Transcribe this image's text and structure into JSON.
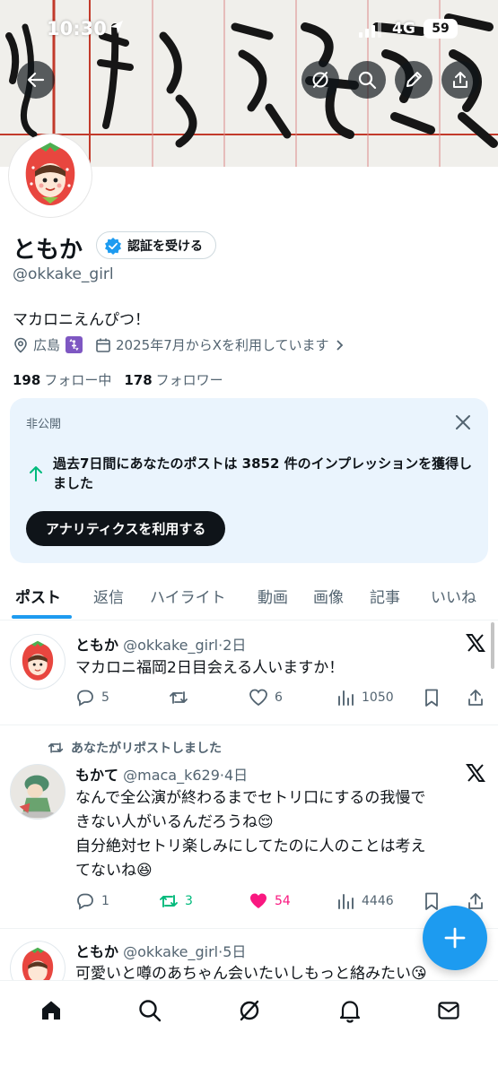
{
  "status_bar": {
    "time": "10:30",
    "network": "4G",
    "battery": "59"
  },
  "header_buttons": [
    "back-icon",
    "grok-icon",
    "search-icon",
    "edit-icon",
    "share-icon"
  ],
  "profile": {
    "name": "ともか",
    "verify_label": "認証を受ける",
    "handle": "@okkake_girl",
    "bio": "マカロニえんぴつ！",
    "location": "広島",
    "joined": "2025年7月からXを利用しています",
    "following_count": "198",
    "following_label": "フォロー中",
    "followers_count": "178",
    "followers_label": "フォロワー"
  },
  "analytics_card": {
    "label": "非公開",
    "message": "過去7日間にあなたのポストは 3852 件のインプレッションを獲得しました",
    "cta": "アナリティクスを利用する"
  },
  "tabs": [
    "ポスト",
    "返信",
    "ハイライト",
    "動画",
    "画像",
    "記事",
    "いいね"
  ],
  "posts": [
    {
      "name": "ともか",
      "handle": "@okkake_girl",
      "time": "2日",
      "text": "マカロニ福岡2日目会える人いますか！",
      "replies": "5",
      "reposts": "",
      "likes": "6",
      "views": "1050"
    },
    {
      "repost_note": "あなたがリポストしました",
      "name": "もかて",
      "handle": "@maca_k629",
      "time": "4日",
      "text_line1": "なんで全公演が終わるまでセトリ口にするの我慢で",
      "text_line2": "きない人がいるんだろうね😌",
      "text_line3": "自分絶対セトリ楽しみにしてたのに人のことは考え",
      "text_line4": "てないね😆",
      "replies": "1",
      "reposts": "3",
      "likes": "54",
      "views": "4446"
    },
    {
      "name": "ともか",
      "handle": "@okkake_girl",
      "time": "5日",
      "text": "可愛いと噂のあちゃん会いたいしもっと絡みたい😘"
    }
  ],
  "colors": {
    "accent": "#1d9bf0",
    "like": "#f91880",
    "repost": "#00ba7c",
    "card_bg": "#eaf4fd"
  },
  "bottom_nav": [
    "home-icon",
    "search-icon",
    "grok-icon",
    "notifications-icon",
    "messages-icon"
  ]
}
